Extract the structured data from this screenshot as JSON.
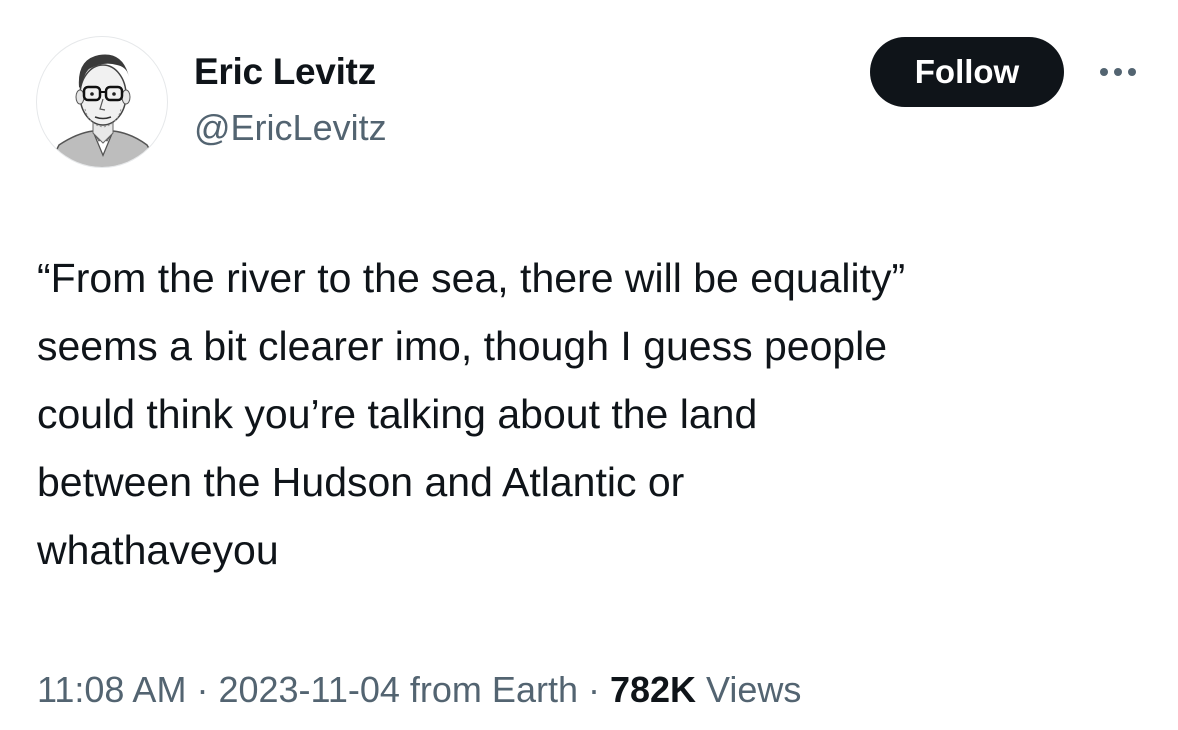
{
  "author": {
    "display_name": "Eric Levitz",
    "handle": "@EricLevitz",
    "avatar": "avatar-portrait-sketch"
  },
  "actions": {
    "follow_label": "Follow",
    "more_icon": "more-horizontal-icon"
  },
  "tweet": {
    "lines": [
      "“From the river to the sea, there will be equality”",
      "seems a bit clearer imo, though I guess people",
      "could think you’re talking about the land",
      "between the Hudson and Atlantic or",
      "whathaveyou"
    ]
  },
  "meta": {
    "time": "11:08 AM",
    "separator": " · ",
    "date": "2023-11-04",
    "source": " from Earth",
    "views_count": "782K",
    "views_label": " Views"
  },
  "colors": {
    "text": "#0f1419",
    "secondary": "#536471",
    "button_bg": "#0f1419",
    "button_text": "#ffffff"
  }
}
